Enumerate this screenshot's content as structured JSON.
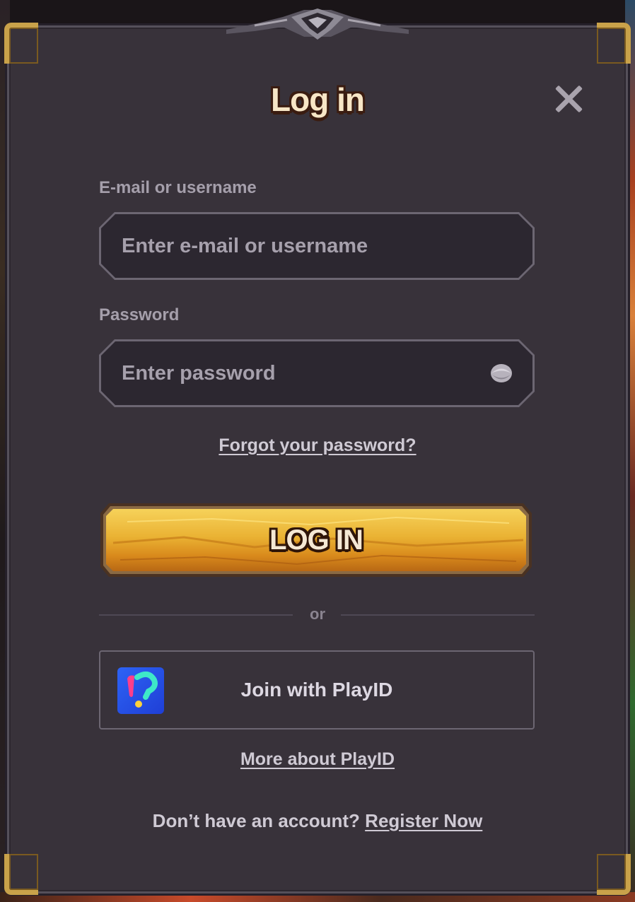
{
  "dialog": {
    "title": "Log in",
    "close_icon": "close-icon"
  },
  "form": {
    "username_label": "E-mail or username",
    "username_placeholder": "Enter e-mail or username",
    "password_label": "Password",
    "password_placeholder": "Enter password",
    "password_toggle_icon": "eye-icon",
    "forgot_link": "Forgot your password?",
    "login_button": "LOG IN"
  },
  "divider": {
    "text": "or"
  },
  "playid": {
    "button_label": "Join with PlayID",
    "logo_icon": "playid-logo-icon",
    "more_link": "More about PlayID"
  },
  "footer": {
    "prompt": "Don’t have an account?",
    "register_link": "Register Now"
  },
  "colors": {
    "modal_bg": "#38323a",
    "gold_button": "#e8a826",
    "text_muted": "#a59fab",
    "title_text": "#f7e6c6"
  }
}
